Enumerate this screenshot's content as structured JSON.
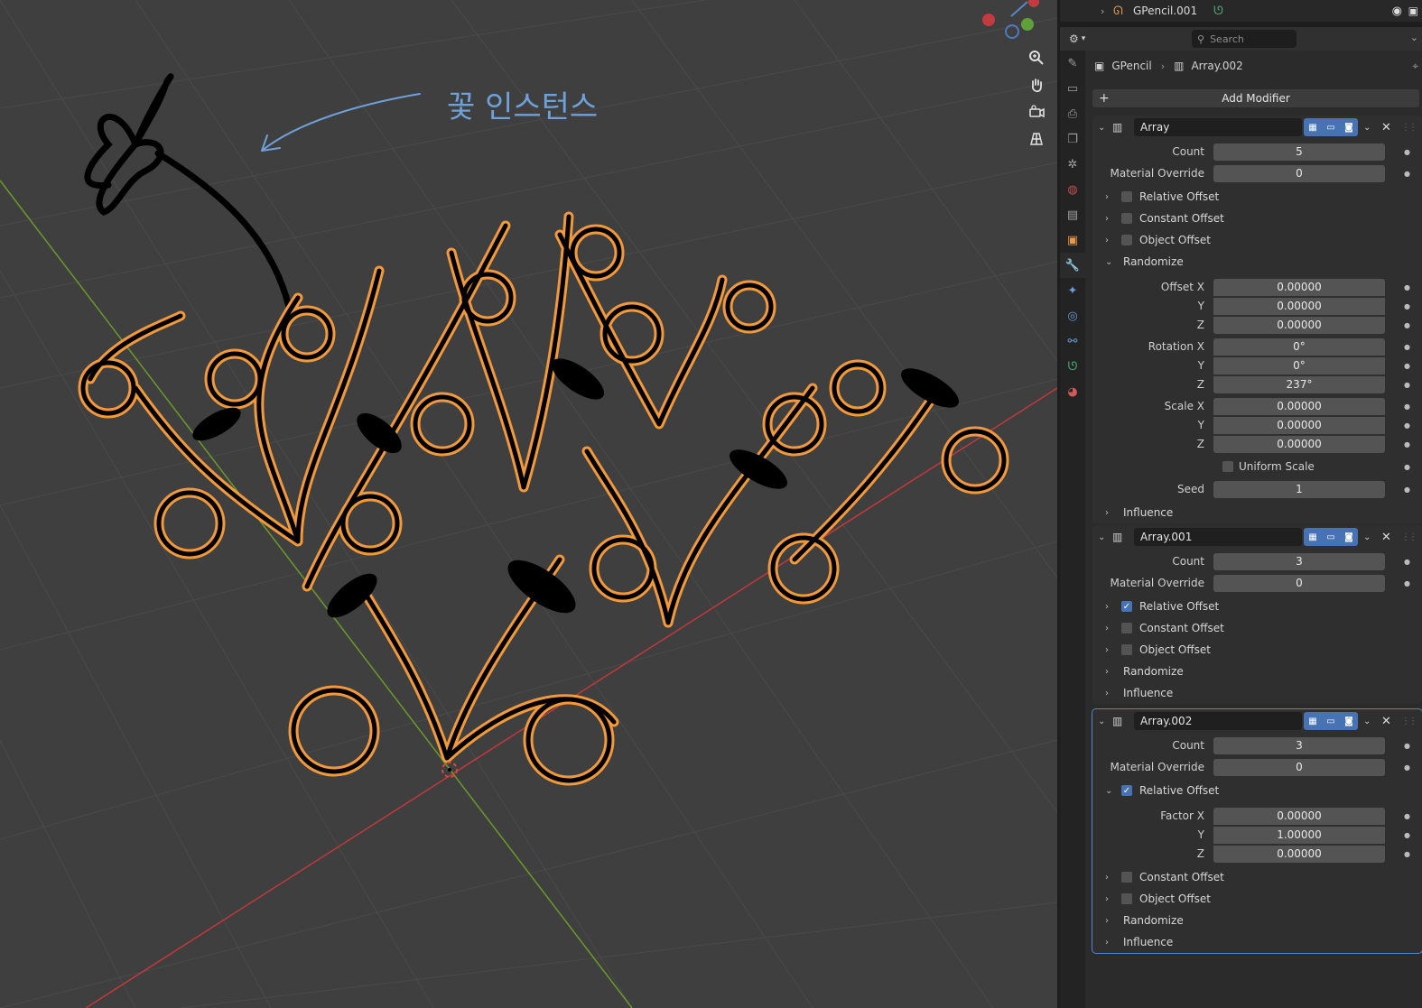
{
  "viewport": {
    "annotation": "꽃 인스턴스"
  },
  "outliner": {
    "object_name": "GPencil.001"
  },
  "properties": {
    "search_placeholder": "Search",
    "breadcrumb": {
      "object": "GPencil",
      "modifier": "Array.002"
    },
    "add_modifier_label": "Add Modifier",
    "modifiers": [
      {
        "name": "Array",
        "count_label": "Count",
        "count": "5",
        "material_override_label": "Material Override",
        "material_override": "0",
        "relative_offset": "Relative Offset",
        "constant_offset": "Constant Offset",
        "object_offset": "Object Offset",
        "randomize": "Randomize",
        "randomize_fields": {
          "offset_x_label": "Offset X",
          "offset_x": "0.00000",
          "offset_y_label": "Y",
          "offset_y": "0.00000",
          "offset_z_label": "Z",
          "offset_z": "0.00000",
          "rotation_x_label": "Rotation X",
          "rotation_x": "0°",
          "rotation_y_label": "Y",
          "rotation_y": "0°",
          "rotation_z_label": "Z",
          "rotation_z": "237°",
          "scale_x_label": "Scale X",
          "scale_x": "0.00000",
          "scale_y_label": "Y",
          "scale_y": "0.00000",
          "scale_z_label": "Z",
          "scale_z": "0.00000",
          "uniform_scale": "Uniform Scale",
          "seed_label": "Seed",
          "seed": "1"
        },
        "influence": "Influence"
      },
      {
        "name": "Array.001",
        "count_label": "Count",
        "count": "3",
        "material_override_label": "Material Override",
        "material_override": "0",
        "relative_offset": "Relative Offset",
        "constant_offset": "Constant Offset",
        "object_offset": "Object Offset",
        "randomize": "Randomize",
        "influence": "Influence"
      },
      {
        "name": "Array.002",
        "count_label": "Count",
        "count": "3",
        "material_override_label": "Material Override",
        "material_override": "0",
        "relative_offset": "Relative Offset",
        "factor_fields": {
          "factor_x_label": "Factor X",
          "factor_x": "0.00000",
          "factor_y_label": "Y",
          "factor_y": "1.00000",
          "factor_z_label": "Z",
          "factor_z": "0.00000"
        },
        "constant_offset": "Constant Offset",
        "object_offset": "Object Offset",
        "randomize": "Randomize",
        "influence": "Influence"
      }
    ]
  },
  "colors": {
    "accent_blue": "#4772b3",
    "selection_orange": "#f29a3b",
    "annotation_blue": "#6fa0d8",
    "x_axis": "#c0393b",
    "y_axis": "#6b9a2a"
  },
  "icons": {
    "zoom": "zoom-icon",
    "pan": "hand-icon",
    "camera": "camera-icon",
    "ortho": "grid-icon"
  }
}
